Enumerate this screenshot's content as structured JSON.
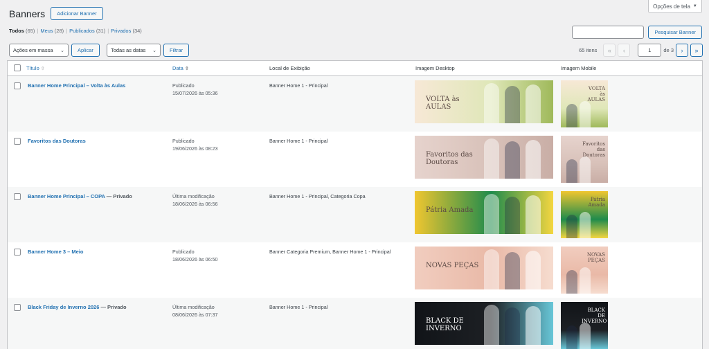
{
  "screen_options": {
    "label": "Opções de tela",
    "chevron": "▼"
  },
  "header": {
    "title": "Banners",
    "add_button": "Adicionar Banner"
  },
  "views": [
    {
      "label": "Todos",
      "count": "(65)",
      "current": true
    },
    {
      "label": "Meus",
      "count": "(28)"
    },
    {
      "label": "Publicados",
      "count": "(31)"
    },
    {
      "label": "Privados",
      "count": "(34)"
    }
  ],
  "search": {
    "value": "",
    "button": "Pesquisar Banner"
  },
  "bulk": {
    "select": "Ações em massa",
    "apply": "Aplicar"
  },
  "filter": {
    "dates": "Todas as datas",
    "button": "Filtrar"
  },
  "pagination": {
    "items": "65 itens",
    "first": "«",
    "prev": "‹",
    "current": "1",
    "of": "de 3",
    "next": "›",
    "last": "»"
  },
  "columns": {
    "title": "Título",
    "date": "Data",
    "local": "Local de Exibição",
    "desktop": "Imagem Desktop",
    "mobile": "Imagem Mobile"
  },
  "rows": [
    {
      "title": "Banner Home Principal – Volta às Aulas",
      "state": "",
      "status": "Publicado",
      "date": "15/07/2026 às 05:36",
      "local": "Banner Home 1 - Principal",
      "desk_text": "VOLTA às AULAS",
      "mob_text": "VOLTA às AULAS",
      "colors": [
        "#f7e8d6",
        "#dfe7b8",
        "#9fb95a"
      ]
    },
    {
      "title": "Favoritos das Doutoras",
      "state": "",
      "status": "Publicado",
      "date": "19/06/2026 às 08:23",
      "local": "Banner Home 1 - Principal",
      "desk_text": "Favoritos das Doutoras",
      "mob_text": "Favoritos das Doutoras",
      "colors": [
        "#e6d3cd",
        "#d8c1b9",
        "#c9aea6"
      ]
    },
    {
      "title": "Banner Home Principal – COPA",
      "state": " — Privado",
      "status": "Última modificação",
      "date": "18/06/2026 às 06:56",
      "local": "Banner Home 1 - Principal, Categoria Copa",
      "desk_text": "Pátria Amada",
      "mob_text": "Pátria Amada",
      "colors": [
        "#f0c630",
        "#1f8b4c",
        "#f4d640"
      ]
    },
    {
      "title": "Banner Home 3 – Meio",
      "state": "",
      "status": "Publicado",
      "date": "18/06/2026 às 06:50",
      "local": "Banner Categoria Premium, Banner Home 1 - Principal",
      "desk_text": "NOVAS PEÇAS",
      "mob_text": "NOVAS PEÇAS",
      "colors": [
        "#f1cdbf",
        "#e9b9a7",
        "#f6dccf"
      ]
    },
    {
      "title": "Black Friday de Inverno 2026",
      "state": " — Privado",
      "status": "Última modificação",
      "date": "08/06/2026 às 07:37",
      "local": "Banner Home 1 - Principal",
      "desk_text": "BLACK DE INVERNO",
      "mob_text": "BLACK DE INVERNO",
      "colors": [
        "#111418",
        "#1d2024",
        "#68c7d8"
      ]
    }
  ]
}
